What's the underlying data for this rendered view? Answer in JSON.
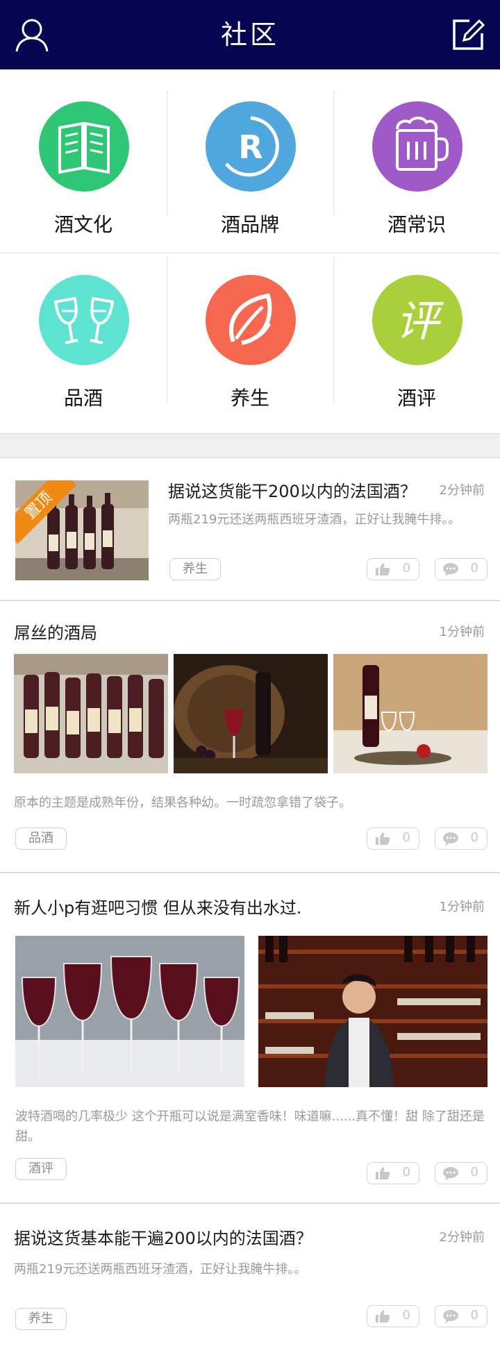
{
  "header": {
    "title": "社区",
    "left_icon": "user-icon",
    "right_icon": "edit-icon"
  },
  "categories": [
    {
      "label": "酒文化",
      "icon": "book-icon",
      "color": "#2fc675"
    },
    {
      "label": "酒品牌",
      "icon": "registered-icon",
      "color": "#4fa7dd"
    },
    {
      "label": "酒常识",
      "icon": "beer-mug-icon",
      "color": "#9f5ac8"
    },
    {
      "label": "品酒",
      "icon": "wine-glasses-icon",
      "color": "#5ee3d3"
    },
    {
      "label": "养生",
      "icon": "leaf-icon",
      "color": "#f5684f"
    },
    {
      "label": "酒评",
      "icon": "review-char-icon",
      "color": "#a9cf3b",
      "glyph": "评"
    }
  ],
  "posts": [
    {
      "title": "据说这货能干200以内的法国酒？",
      "time": "2分钟前",
      "desc": "两瓶219元还送两瓶西班牙渣酒，正好让我腌牛排。。",
      "tag": "养生",
      "likes": "0",
      "comments": "0",
      "pinned_label": "置顶"
    },
    {
      "title": "屌丝的酒局",
      "time": "1分钟前",
      "desc": "原本的主题是成熟年份，结果各种幼。一时疏忽拿错了袋子。",
      "tag": "品酒",
      "likes": "0",
      "comments": "0"
    },
    {
      "title": "新人小p有逛吧习惯 但从来没有出水过.",
      "time": "1分钟前",
      "desc": "波特酒喝的几率极少 这个开瓶可以说是满室香味！味道嘛......真不懂！甜 除了甜还是甜。",
      "tag": "酒评",
      "likes": "0",
      "comments": "0"
    },
    {
      "title": "据说这货基本能干遍200以内的法国酒？",
      "time": "2分钟前",
      "desc": "两瓶219元还送两瓶西班牙渣酒，正好让我腌牛排。。",
      "tag": "养生",
      "likes": "0",
      "comments": "0"
    }
  ],
  "colors": {
    "header_bg": "#050552",
    "accent_orange": "#f08a14"
  }
}
